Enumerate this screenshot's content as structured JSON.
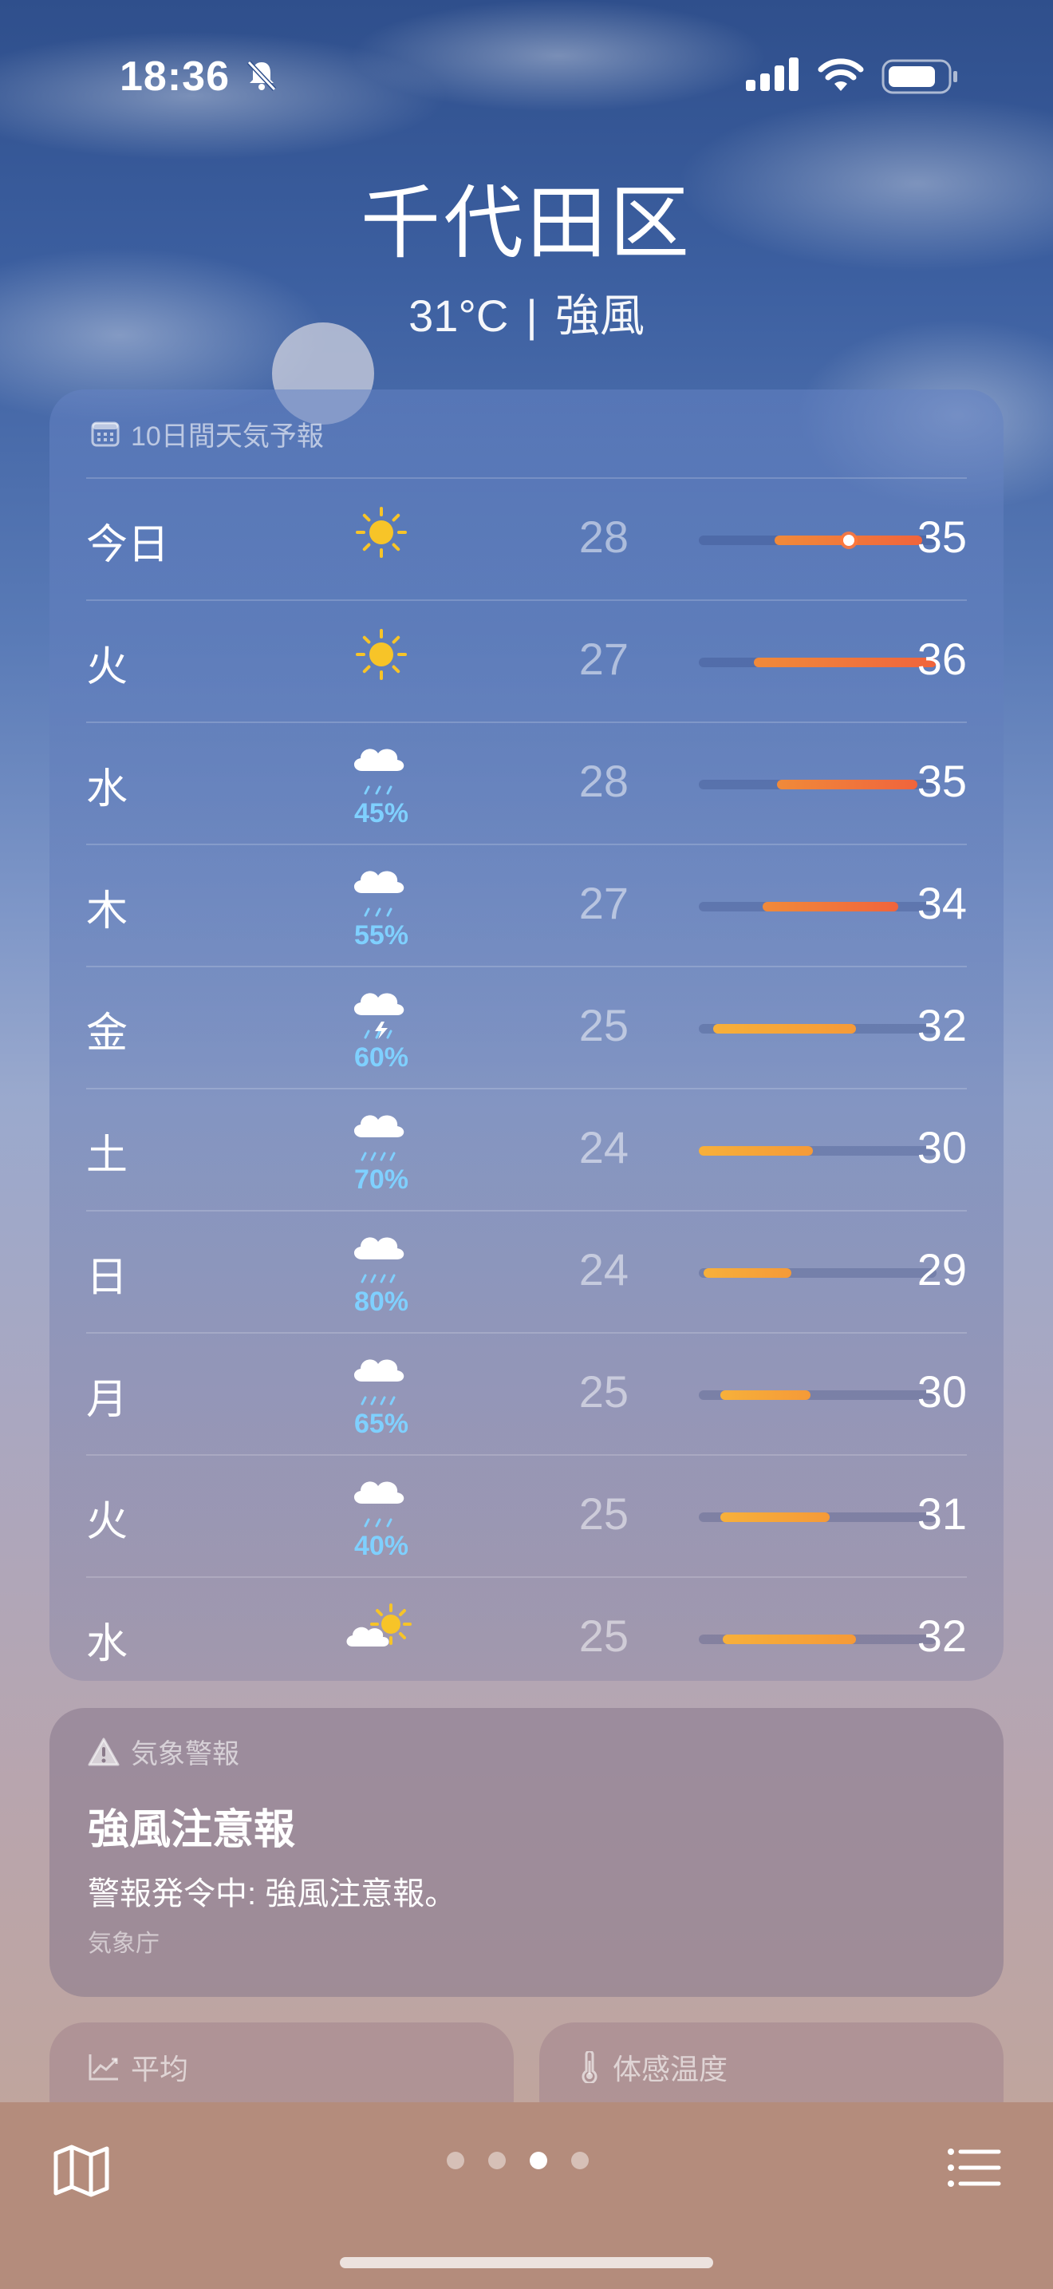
{
  "status": {
    "time": "18:36"
  },
  "header": {
    "city": "千代田区",
    "temp": "31°C",
    "separator": "|",
    "condition": "強風"
  },
  "forecast": {
    "title": "10日間天気予報",
    "rows": [
      {
        "day": "今日",
        "icon": "sun-icon",
        "precip": "",
        "lo": "28",
        "hi": "35",
        "range": [
          0.32,
          0.94
        ],
        "current": 0.63
      },
      {
        "day": "火",
        "icon": "sun-icon",
        "precip": "",
        "lo": "27",
        "hi": "36",
        "range": [
          0.23,
          1.0
        ]
      },
      {
        "day": "水",
        "icon": "cloud-rain-icon",
        "precip": "45%",
        "lo": "28",
        "hi": "35",
        "range": [
          0.33,
          0.92
        ]
      },
      {
        "day": "木",
        "icon": "cloud-rain-icon",
        "precip": "55%",
        "lo": "27",
        "hi": "34",
        "range": [
          0.27,
          0.84
        ]
      },
      {
        "day": "金",
        "icon": "cloud-bolt-rain-icon",
        "precip": "60%",
        "lo": "25",
        "hi": "32",
        "range": [
          0.06,
          0.66
        ]
      },
      {
        "day": "土",
        "icon": "cloud-heavy-rain-icon",
        "precip": "70%",
        "lo": "24",
        "hi": "30",
        "range": [
          0.0,
          0.48
        ]
      },
      {
        "day": "日",
        "icon": "cloud-heavy-rain-icon",
        "precip": "80%",
        "lo": "24",
        "hi": "29",
        "range": [
          0.02,
          0.39
        ]
      },
      {
        "day": "月",
        "icon": "cloud-heavy-rain-icon",
        "precip": "65%",
        "lo": "25",
        "hi": "30",
        "range": [
          0.09,
          0.47
        ]
      },
      {
        "day": "火",
        "icon": "cloud-rain-icon",
        "precip": "40%",
        "lo": "25",
        "hi": "31",
        "range": [
          0.09,
          0.55
        ]
      },
      {
        "day": "水",
        "icon": "partly-sunny-icon",
        "precip": "",
        "lo": "25",
        "hi": "32",
        "range": [
          0.1,
          0.66
        ]
      }
    ]
  },
  "alert": {
    "label": "気象警報",
    "title": "強風注意報",
    "text": "警報発令中: 強風注意報。",
    "source": "気象庁"
  },
  "widgets": {
    "average": "平均",
    "feels_like": "体感温度"
  },
  "colors": {
    "hot": "#f0643c",
    "warm": "#f59a38"
  }
}
